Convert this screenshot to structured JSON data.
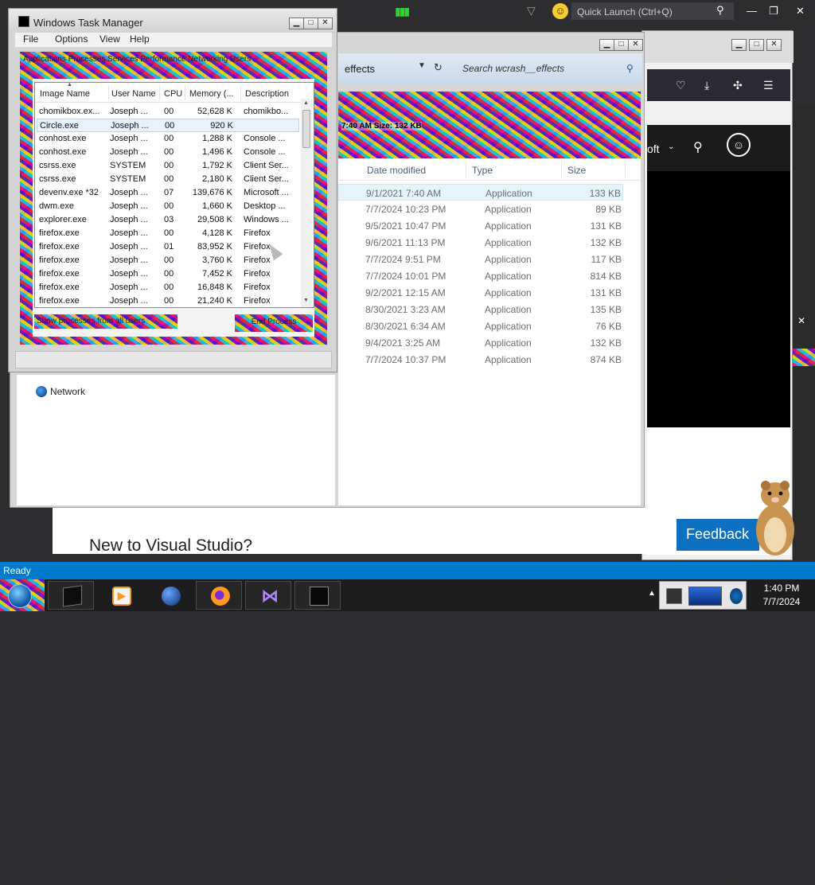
{
  "vs": {
    "quick_launch_placeholder": "Quick Launch (Ctrl+Q)",
    "status": "Ready",
    "start_page_title": "New to Visual Studio?",
    "feedback_label": "Feedback",
    "accent": "#007acc"
  },
  "explorer": {
    "address_crumb": "effects",
    "search_placeholder": "Search wcrash__effects",
    "banner_text": "7:40 AM    Size: 132 KB",
    "columns": {
      "date": "Date modified",
      "type": "Type",
      "size": "Size"
    },
    "rows": [
      {
        "date": "9/1/2021 7:40 AM",
        "type": "Application",
        "size": "133 KB"
      },
      {
        "date": "7/7/2024 10:23 PM",
        "type": "Application",
        "size": "89 KB"
      },
      {
        "date": "9/5/2021 10:47 PM",
        "type": "Application",
        "size": "131 KB"
      },
      {
        "date": "9/6/2021 11:13 PM",
        "type": "Application",
        "size": "132 KB"
      },
      {
        "date": "7/7/2024 9:51 PM",
        "type": "Application",
        "size": "117 KB"
      },
      {
        "date": "7/7/2024 10:01 PM",
        "type": "Application",
        "size": "814 KB"
      },
      {
        "date": "9/2/2021 12:15 AM",
        "type": "Application",
        "size": "131 KB"
      },
      {
        "date": "8/30/2021 3:23 AM",
        "type": "Application",
        "size": "135 KB"
      },
      {
        "date": "8/30/2021 6:34 AM",
        "type": "Application",
        "size": "76 KB"
      },
      {
        "date": "9/4/2021 3:25 AM",
        "type": "Application",
        "size": "132 KB"
      },
      {
        "date": "7/7/2024 10:37 PM",
        "type": "Application",
        "size": "874 KB"
      }
    ],
    "network_label": "Network"
  },
  "taskmgr": {
    "title": "Windows Task Manager",
    "menu": [
      "File",
      "Options",
      "View",
      "Help"
    ],
    "tabs_text": "Applications  Processes  Services  Performance  Networking  Users",
    "columns": {
      "name": "Image Name",
      "user": "User Name",
      "cpu": "CPU",
      "mem": "Memory (...",
      "desc": "Description"
    },
    "rows": [
      {
        "name": "chomikbox.ex...",
        "user": "Joseph ...",
        "cpu": "00",
        "mem": "52,628 K",
        "desc": "chomikbo..."
      },
      {
        "name": "Circle.exe",
        "user": "Joseph ...",
        "cpu": "00",
        "mem": "920 K",
        "desc": ""
      },
      {
        "name": "conhost.exe",
        "user": "Joseph ...",
        "cpu": "00",
        "mem": "1,288 K",
        "desc": "Console ..."
      },
      {
        "name": "conhost.exe",
        "user": "Joseph ...",
        "cpu": "00",
        "mem": "1,496 K",
        "desc": "Console ..."
      },
      {
        "name": "csrss.exe",
        "user": "SYSTEM",
        "cpu": "00",
        "mem": "1,792 K",
        "desc": "Client Ser..."
      },
      {
        "name": "csrss.exe",
        "user": "SYSTEM",
        "cpu": "00",
        "mem": "2,180 K",
        "desc": "Client Ser..."
      },
      {
        "name": "devenv.exe *32",
        "user": "Joseph ...",
        "cpu": "07",
        "mem": "139,676 K",
        "desc": "Microsoft ..."
      },
      {
        "name": "dwm.exe",
        "user": "Joseph ...",
        "cpu": "00",
        "mem": "1,660 K",
        "desc": "Desktop ..."
      },
      {
        "name": "explorer.exe",
        "user": "Joseph ...",
        "cpu": "03",
        "mem": "29,508 K",
        "desc": "Windows ..."
      },
      {
        "name": "firefox.exe",
        "user": "Joseph ...",
        "cpu": "00",
        "mem": "4,128 K",
        "desc": "Firefox"
      },
      {
        "name": "firefox.exe",
        "user": "Joseph ...",
        "cpu": "01",
        "mem": "83,952 K",
        "desc": "Firefox"
      },
      {
        "name": "firefox.exe",
        "user": "Joseph ...",
        "cpu": "00",
        "mem": "3,760 K",
        "desc": "Firefox"
      },
      {
        "name": "firefox.exe",
        "user": "Joseph ...",
        "cpu": "00",
        "mem": "7,452 K",
        "desc": "Firefox"
      },
      {
        "name": "firefox.exe",
        "user": "Joseph ...",
        "cpu": "00",
        "mem": "16,848 K",
        "desc": "Firefox"
      },
      {
        "name": "firefox.exe",
        "user": "Joseph ...",
        "cpu": "00",
        "mem": "21,240 K",
        "desc": "Firefox"
      }
    ],
    "show_all": "Show processes from all users",
    "end_process": "End Process"
  },
  "browser": {
    "nav_text": "oft"
  },
  "taskbar": {
    "clock_time": "1:40 PM",
    "clock_date": "7/7/2024",
    "buttons": [
      "task-manager",
      "media-player",
      "globe",
      "firefox",
      "visual-studio",
      "terminal"
    ]
  }
}
